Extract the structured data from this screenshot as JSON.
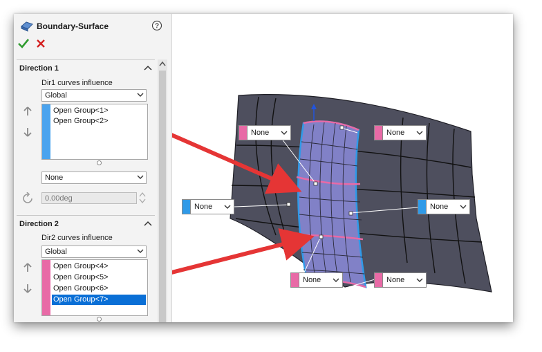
{
  "colors": {
    "accent_blue": "#2f9ae8",
    "accent_pink": "#e86aa6",
    "surface": "#4f5060",
    "patch": "#7f7fc6",
    "arrow_red": "#e53535"
  },
  "header": {
    "title": "Boundary-Surface",
    "icons": [
      "boundary-surface-icon",
      "help-icon",
      "ok-check-icon",
      "cancel-x-icon"
    ]
  },
  "direction1": {
    "title": "Direction 1",
    "influence_label": "Dir1 curves influence",
    "influence_value": "Global",
    "items": [
      "Open Group<1>",
      "Open Group<2>"
    ],
    "tangency_value": "None",
    "angle_value": "0.00deg"
  },
  "direction2": {
    "title": "Direction 2",
    "influence_label": "Dir2 curves influence",
    "influence_value": "Global",
    "items": [
      "Open Group<4>",
      "Open Group<5>",
      "Open Group<6>",
      "Open Group<7>"
    ],
    "selected_index": 3
  },
  "callouts": [
    {
      "id": "top-left",
      "value": "None",
      "color": "pink"
    },
    {
      "id": "top-right",
      "value": "None",
      "color": "pink"
    },
    {
      "id": "mid-left",
      "value": "None",
      "color": "blue"
    },
    {
      "id": "mid-right",
      "value": "None",
      "color": "blue"
    },
    {
      "id": "bottom-left",
      "value": "None",
      "color": "pink"
    },
    {
      "id": "bottom-right",
      "value": "None",
      "color": "pink"
    }
  ]
}
